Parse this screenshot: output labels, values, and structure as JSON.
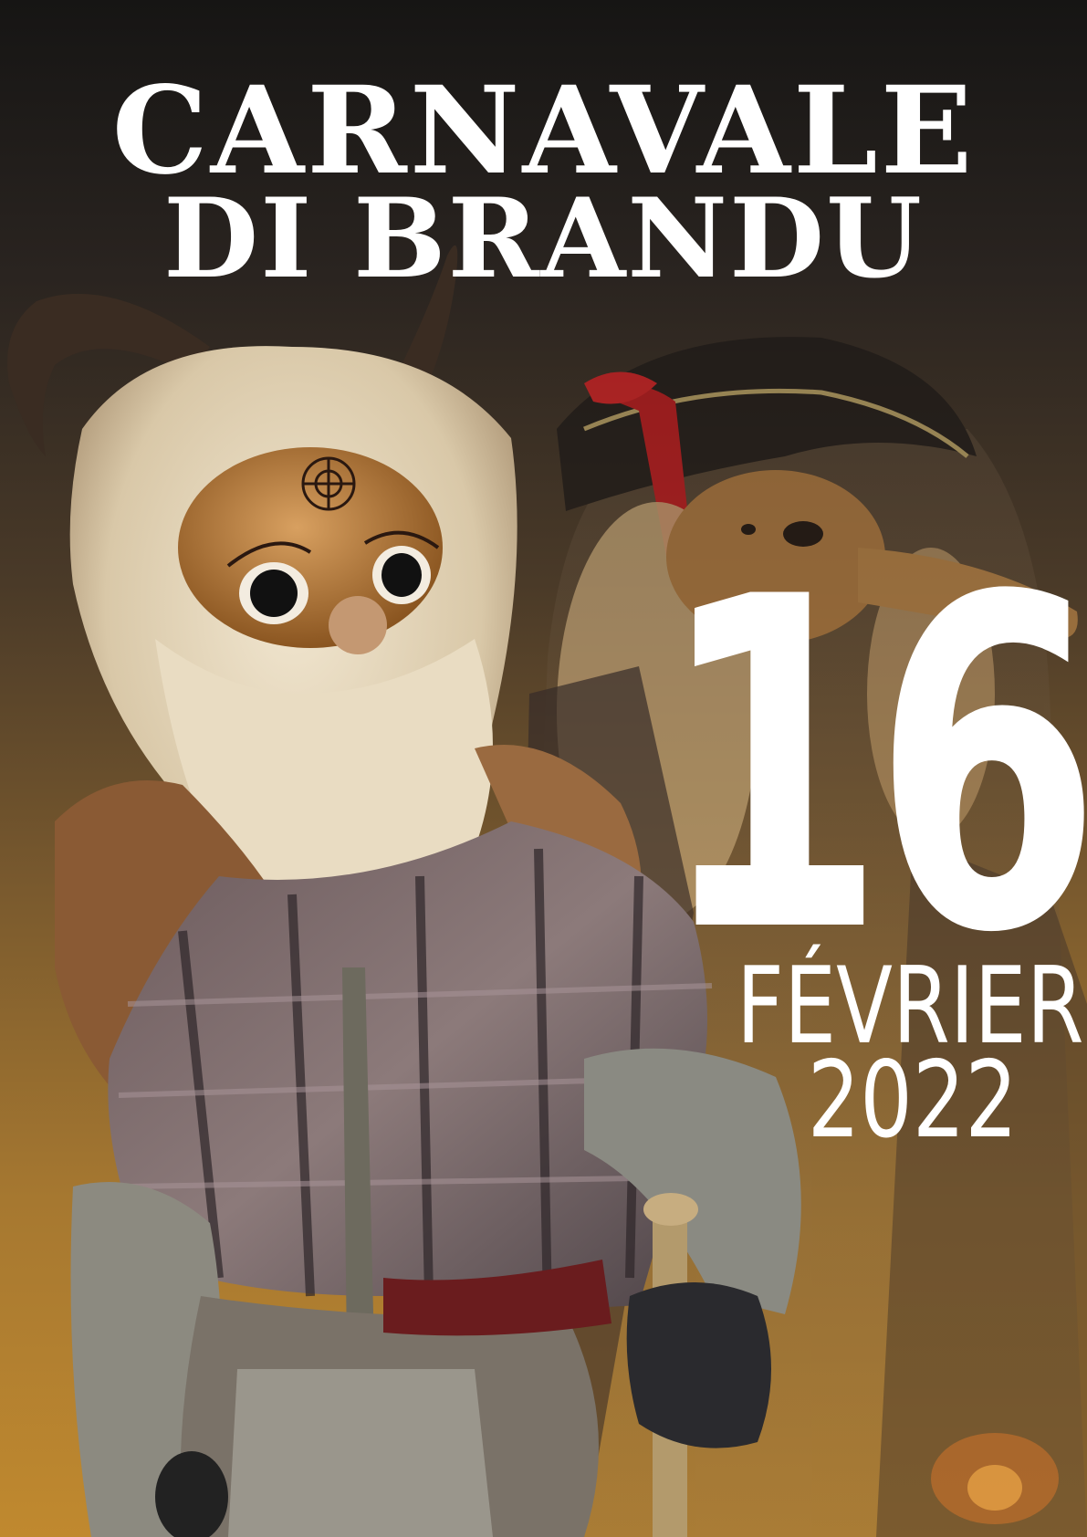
{
  "title": {
    "line1": "CARNAVALE",
    "line2": "DI BRANDU"
  },
  "date": {
    "day": "16",
    "month": "FÉVRIER",
    "year": "2022"
  },
  "colors": {
    "text": "#ffffff",
    "background_top": "#161514",
    "background_bottom": "#c0892f"
  }
}
